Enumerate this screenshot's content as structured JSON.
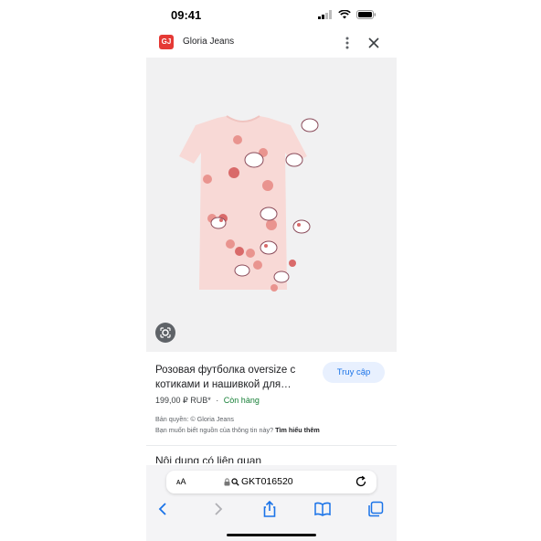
{
  "status_bar": {
    "time": "09:41"
  },
  "app_bar": {
    "logo_text": "GJ",
    "title": "Gloria Jeans"
  },
  "product": {
    "title": "Розовая футболка oversize с котиками и нашивкой для…",
    "price": "199,00 ₽ RUB*",
    "separator": "·",
    "stock": "Còn hàng",
    "visit_label": "Truy cập",
    "copyright": "Bản quyền: © Gloria Jeans",
    "source_question": "Bạn muốn biết nguồn của thông tin này?",
    "learn_more": "Tìm hiểu thêm"
  },
  "related_heading": "Nội dung có liên quan",
  "browser": {
    "text_size_label": "ᴀA",
    "url": "GKT016520"
  },
  "colors": {
    "accent": "#1a73e8",
    "stock": "#188038",
    "shirt": "#f8d9d6",
    "brand": "#e53935"
  }
}
